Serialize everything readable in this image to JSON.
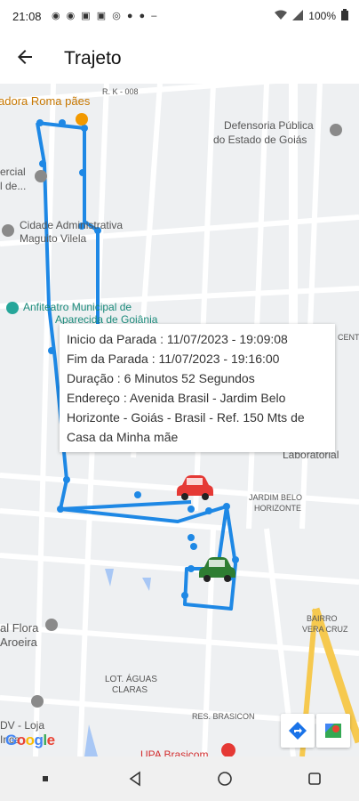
{
  "status": {
    "time": "21:08",
    "left_icons": [
      "whatsapp-icon",
      "whatsapp-icon",
      "image-icon",
      "notification-icon",
      "messenger-icon",
      "app-icon",
      "app-icon",
      "more-icon"
    ],
    "battery": "100%"
  },
  "appbar": {
    "title": "Trajeto"
  },
  "map": {
    "labels": {
      "l1": "adora Roma pães",
      "l2": "R. K - 008",
      "l3": "Defensoria Pública",
      "l4": "do Estado de Goiás",
      "l5": "ercial",
      "l6": "l de...",
      "l7": "Cidade Administrativa",
      "l8": "Maguito Vilela",
      "l9": "Anfiteatro Municipal de",
      "l10": "Aparecida de Goiânia",
      "l11": "JARDIM BELO",
      "l12": "HORIZONTE",
      "l13": "BAIRRO",
      "l14": "VERA CRUZ",
      "l15": "LOT. ÁGUAS",
      "l16": "CLARAS",
      "l17": "RES. BRASICON",
      "l18": "UPA Brasicom",
      "l19": "al Flora",
      "l20": "Aroeira",
      "l21": "DV - Loja",
      "l22": "Inca",
      "l23": "Laboratorial",
      "l24": "CENTR"
    },
    "google_logo": "Google"
  },
  "infobox": {
    "line1": "Inicio da Parada : 11/07/2023 - 19:09:08",
    "line2": "Fim da Parada : 11/07/2023 - 19:16:00",
    "line3": "Duração : 6 Minutos 52 Segundos",
    "line4": "Endereço : Avenida Brasil - Jardim Belo",
    "line5": "Horizonte - Goiás - Brasil - Ref. 150 Mts de",
    "line6": "Casa da Minha mãe"
  },
  "colors": {
    "route": "#1e88e5",
    "car_red": "#e53935",
    "car_green": "#2e7d32"
  }
}
